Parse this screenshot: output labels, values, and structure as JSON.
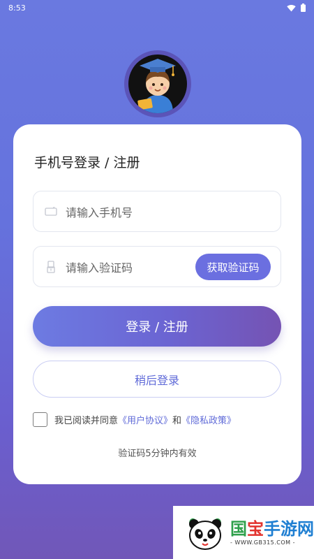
{
  "status_bar": {
    "time": "8:53"
  },
  "login": {
    "title": "手机号登录 / 注册",
    "phone_placeholder": "请输入手机号",
    "code_placeholder": "请输入验证码",
    "get_code_label": "获取验证码",
    "submit_label": "登录 / 注册",
    "later_label": "稍后登录",
    "agreement": {
      "prefix": "我已阅读并同意",
      "user_agreement": "《用户协议》",
      "conjunction": "和",
      "privacy_policy": "《隐私政策》",
      "checked": false
    },
    "hint": "验证码5分钟内有效"
  },
  "watermark": {
    "title_chars": [
      "国",
      "宝",
      "手游网"
    ],
    "subtitle": "- WWW.GB315.COM -"
  },
  "colors": {
    "accent": "#6b6fe0",
    "link": "#5f6ad8",
    "background_top": "#6a79e0",
    "background_bottom": "#7157b8"
  },
  "icons": {
    "wifi": "wifi-icon",
    "battery": "battery-icon",
    "phone": "phone-card-icon",
    "code": "lock-code-icon",
    "avatar": "graduate-boy-avatar"
  }
}
